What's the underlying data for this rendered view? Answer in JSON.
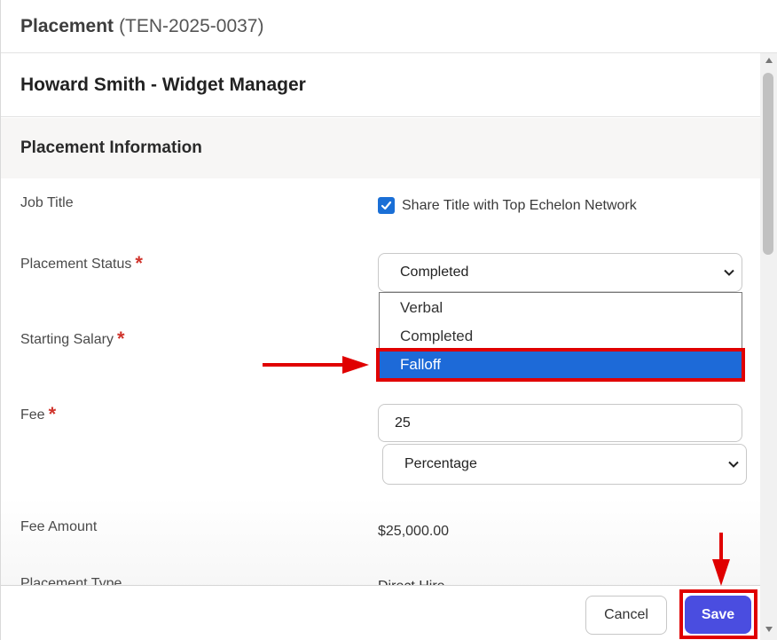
{
  "header": {
    "title": "Placement",
    "record_id": "(TEN-2025-0037)"
  },
  "subheader": {
    "title": "Howard Smith - Widget Manager"
  },
  "section": {
    "title": "Placement Information"
  },
  "fields": {
    "job_title": {
      "label": "Job Title",
      "checkbox_label": "Share Title with Top Echelon Network",
      "checked": true
    },
    "placement_status": {
      "label": "Placement Status",
      "required_mark": "*",
      "value": "Completed",
      "options": [
        "Verbal",
        "Completed",
        "Falloff"
      ],
      "highlighted_option": "Falloff"
    },
    "starting_salary": {
      "label": "Starting Salary",
      "required_mark": "*"
    },
    "fee": {
      "label": "Fee",
      "required_mark": "*",
      "value": "25",
      "type_value": "Percentage"
    },
    "fee_amount": {
      "label": "Fee Amount",
      "value": "$25,000.00"
    },
    "placement_type": {
      "label": "Placement Type",
      "value": "Direct Hire"
    }
  },
  "footer": {
    "cancel_label": "Cancel",
    "save_label": "Save"
  },
  "colors": {
    "accent": "#4a4de0",
    "selected_option": "#1d6ad8",
    "annotation": "#e00000",
    "required": "#d0342c"
  },
  "icons": [
    "chevron-down-icon",
    "checkmark-icon",
    "scroll-up-icon",
    "scroll-down-icon",
    "annotation-arrow-icon"
  ]
}
